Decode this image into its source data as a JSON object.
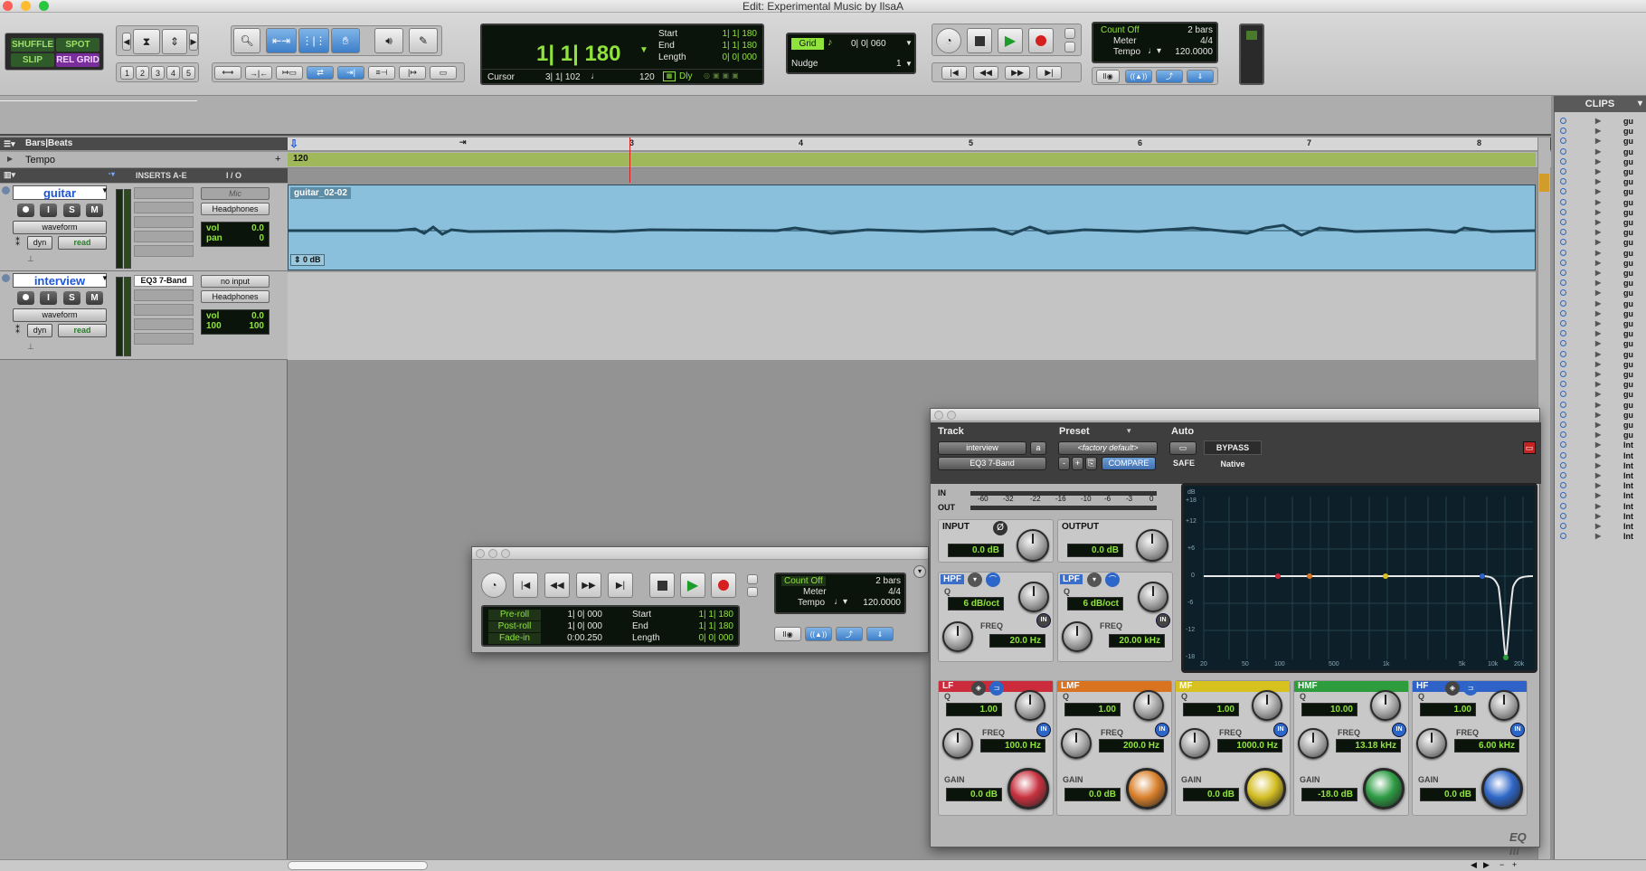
{
  "window": {
    "title": "Edit: Experimental Music by IlsaA"
  },
  "edit_modes": [
    "SHUFFLE",
    "SPOT",
    "SLIP",
    "REL GRID"
  ],
  "zoom_presets": [
    "1",
    "2",
    "3",
    "4",
    "5"
  ],
  "counter": {
    "main": "1| 1| 180",
    "start_label": "Start",
    "start": "1| 1| 180",
    "end_label": "End",
    "end": "1| 1| 180",
    "length_label": "Length",
    "length": "0| 0| 000",
    "cursor_label": "Cursor",
    "cursor": "3| 1| 102",
    "cursor_val": "120",
    "dly": "Dly"
  },
  "grid": {
    "label": "Grid",
    "value": "0| 0| 060",
    "nudge_label": "Nudge",
    "nudge": "1"
  },
  "count_display": {
    "count_off": "Count Off",
    "bars": "2 bars",
    "meter_label": "Meter",
    "meter": "4/4",
    "tempo_label": "Tempo",
    "tempo": "120.0000"
  },
  "rulers": {
    "bars_beats": "Bars|Beats",
    "tempo": "Tempo",
    "tempo_value": "120",
    "bar_numbers": [
      "3",
      "4",
      "5",
      "6",
      "7",
      "8"
    ]
  },
  "columns": {
    "inserts": "INSERTS A-E",
    "io": "I / O"
  },
  "tracks": [
    {
      "name": "guitar",
      "view": "waveform",
      "dyn": "dyn",
      "auto": "read",
      "insert": "",
      "input": "Mic",
      "output": "Headphones",
      "vol_label": "vol",
      "vol": "0.0",
      "pan_label": "pan",
      "pan": "0",
      "clip": "guitar_02-02",
      "clip_gain": "0 dB"
    },
    {
      "name": "interview",
      "view": "waveform",
      "dyn": "dyn",
      "auto": "read",
      "insert": "EQ3 7-Band",
      "input": "no input",
      "output": "Headphones",
      "vol_label": "vol",
      "vol": "0.0",
      "pan_l": "100",
      "pan_r": "100"
    }
  ],
  "clips_panel": {
    "title": "CLIPS",
    "items": [
      "gu",
      "gu",
      "gu",
      "gu",
      "gu",
      "gu",
      "gu",
      "gu",
      "gu",
      "gu",
      "gu",
      "gu",
      "gu",
      "gu",
      "gu",
      "gu",
      "gu",
      "gu",
      "gu",
      "gu",
      "gu",
      "gu",
      "gu",
      "gu",
      "gu",
      "gu",
      "gu",
      "gu",
      "gu",
      "gu",
      "gu",
      "gu",
      "Int",
      "Int",
      "Int",
      "Int",
      "Int",
      "Int",
      "Int",
      "Int",
      "Int",
      "Int"
    ]
  },
  "transport_window": {
    "preroll_label": "Pre-roll",
    "preroll": "1| 0| 000",
    "postroll_label": "Post-roll",
    "postroll": "1| 0| 000",
    "fadein_label": "Fade-in",
    "fadein": "0:00.250",
    "start_label": "Start",
    "start": "1| 1| 180",
    "end_label": "End",
    "end": "1| 1| 180",
    "length_label": "Length",
    "length": "0| 0| 000",
    "count_off": "Count Off",
    "bars": "2 bars",
    "meter_label": "Meter",
    "meter": "4/4",
    "tempo_label": "Tempo",
    "tempo": "120.0000"
  },
  "eq": {
    "track_label": "Track",
    "preset_label": "Preset",
    "auto_label": "Auto",
    "track": "interview",
    "track_suffix": "a",
    "plugin": "EQ3 7-Band",
    "preset": "<factory default>",
    "compare": "COMPARE",
    "bypass": "BYPASS",
    "safe": "SAFE",
    "native": "Native",
    "in_label": "IN",
    "out_label": "OUT",
    "meter_ticks": [
      "-60",
      "-32",
      "-22",
      "-16",
      "-10",
      "-6",
      "-3",
      "0"
    ],
    "input_label": "INPUT",
    "input": "0.0 dB",
    "output_label": "OUTPUT",
    "output": "0.0 dB",
    "hpf": {
      "name": "HPF",
      "q_label": "Q",
      "q": "6 dB/oct",
      "freq_label": "FREQ",
      "freq": "20.0 Hz"
    },
    "lpf": {
      "name": "LPF",
      "q_label": "Q",
      "q": "6 dB/oct",
      "freq_label": "FREQ",
      "freq": "20.00 kHz"
    },
    "graph_y": [
      "dB",
      "+18",
      "+12",
      "+6",
      "0",
      "-6",
      "-12",
      "-18"
    ],
    "graph_x": [
      "20",
      "50",
      "100",
      "500",
      "1k",
      "5k",
      "10k",
      "20k"
    ],
    "bands": [
      {
        "name": "LF",
        "color": "#cc2b3b",
        "q": "1.00",
        "freq": "100.0 Hz",
        "gain": "0.0 dB",
        "gain_color": "#c8323f"
      },
      {
        "name": "LMF",
        "color": "#d9731f",
        "q": "1.00",
        "freq": "200.0 Hz",
        "gain": "0.0 dB",
        "gain_color": "#d9812c"
      },
      {
        "name": "MF",
        "color": "#d6c11e",
        "q": "1.00",
        "freq": "1000.0 Hz",
        "gain": "0.0 dB",
        "gain_color": "#d4be23"
      },
      {
        "name": "HMF",
        "color": "#2c9c3c",
        "q": "10.00",
        "freq": "13.18 kHz",
        "gain": "-18.0 dB",
        "gain_color": "#2e9c44"
      },
      {
        "name": "HF",
        "color": "#2e62c9",
        "q": "1.00",
        "freq": "6.00 kHz",
        "gain": "0.0 dB",
        "gain_color": "#2f67c8"
      }
    ],
    "band_labels": {
      "q": "Q",
      "freq": "FREQ",
      "gain": "GAIN"
    },
    "logo": "EQ III"
  }
}
